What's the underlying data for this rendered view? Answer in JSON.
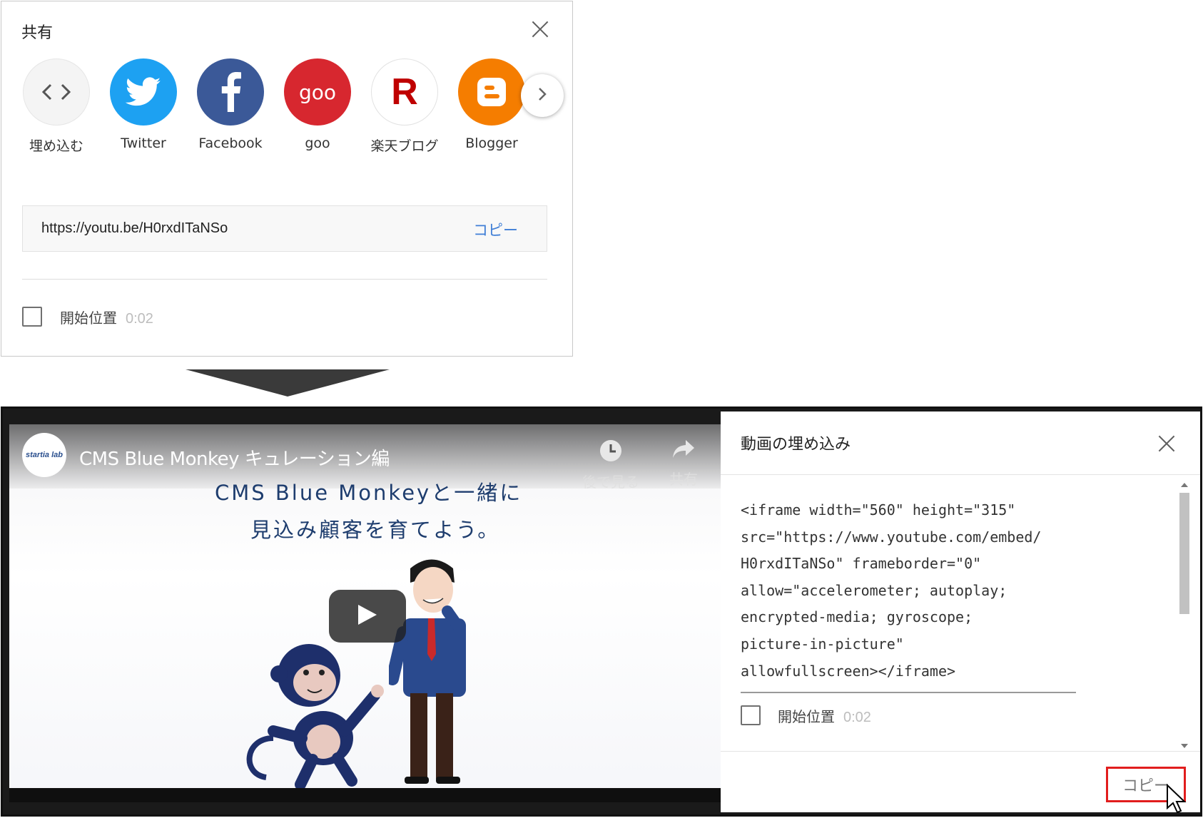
{
  "share_dialog": {
    "title": "共有",
    "targets": [
      {
        "label": "埋め込む",
        "icon": "embed-code-icon",
        "color": "#f4f4f4"
      },
      {
        "label": "Twitter",
        "icon": "twitter-icon",
        "color": "#1da1f2"
      },
      {
        "label": "Facebook",
        "icon": "facebook-icon",
        "color": "#3b5998"
      },
      {
        "label": "goo",
        "icon": "goo-icon",
        "color": "#d7272f",
        "glyph": "goo"
      },
      {
        "label": "楽天ブログ",
        "icon": "rakuten-icon",
        "color": "#ffffff",
        "glyph": "R"
      },
      {
        "label": "Blogger",
        "icon": "blogger-icon",
        "color": "#f57d00"
      }
    ],
    "url": "https://youtu.be/H0rxdITaNSo",
    "copy_label": "コピー",
    "start_label": "開始位置",
    "start_time": "0:02"
  },
  "player": {
    "channel_logo_text": "startia lab",
    "video_title": "CMS Blue Monkey キュレーション編",
    "watch_later_label": "後で見る",
    "share_label": "共有",
    "caption_line1": "CMS Blue Monkeyと一緒に",
    "caption_line2": "見込み顧客を育てよう。"
  },
  "embed_panel": {
    "title": "動画の埋め込み",
    "code_lines": [
      "<iframe width=\"560\" height=\"315\"",
      "src=\"https://www.youtube.com/embed/",
      "H0rxdITaNSo\" frameborder=\"0\"",
      "allow=\"accelerometer; autoplay;",
      "encrypted-media; gyroscope;",
      "picture-in-picture\"",
      "allowfullscreen></iframe>"
    ],
    "start_label": "開始位置",
    "start_time": "0:02",
    "copy_label": "コピー"
  },
  "colors": {
    "accent_blue": "#3f7ed6",
    "highlight_red": "#e11d1d"
  }
}
